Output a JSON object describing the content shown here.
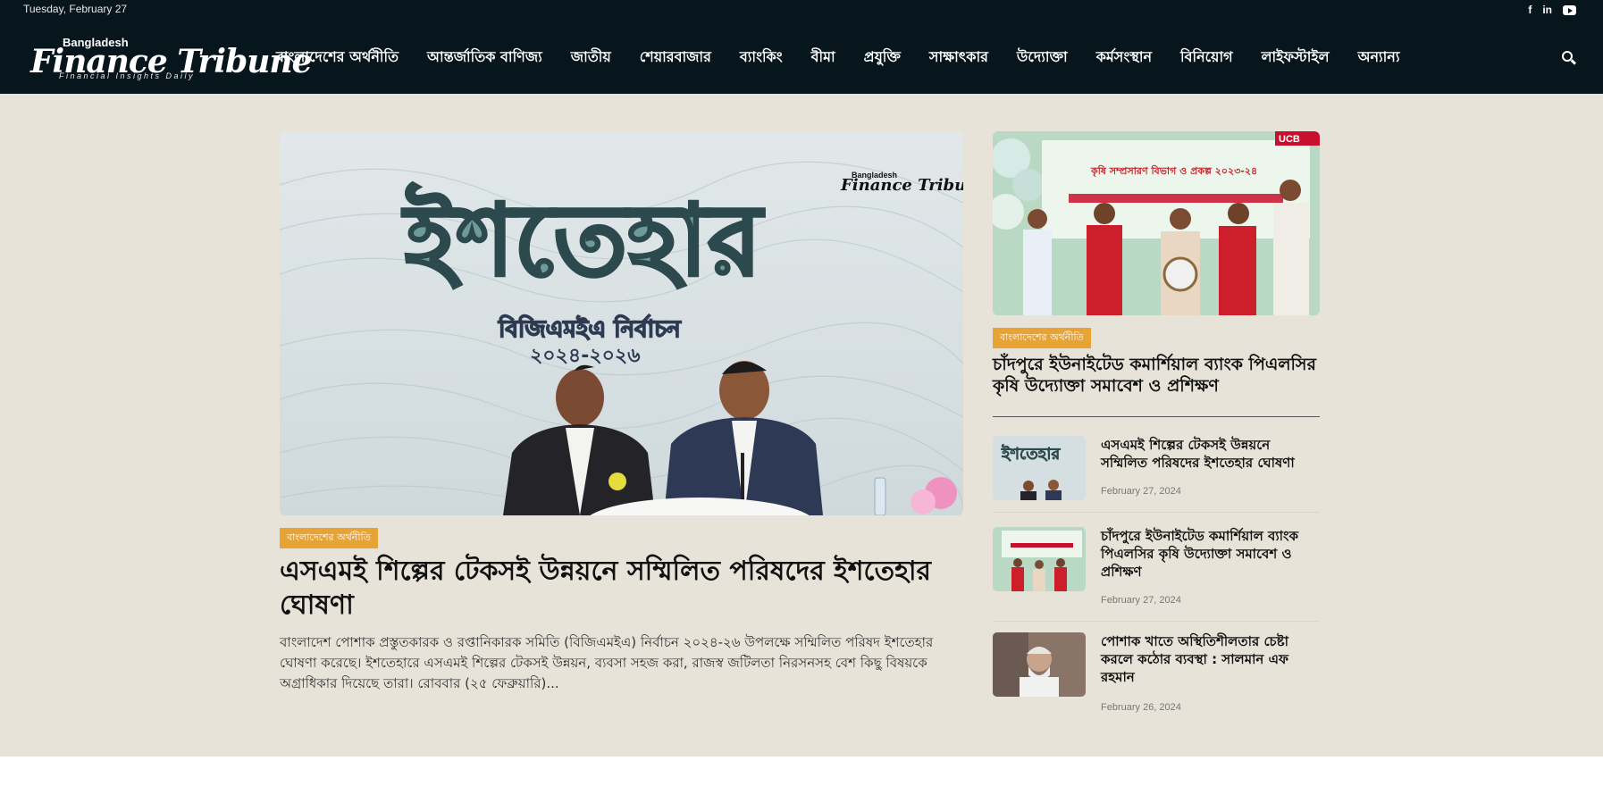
{
  "topbar": {
    "date": "Tuesday, February 27",
    "social": [
      "facebook-icon",
      "linkedin-icon",
      "youtube-icon"
    ],
    "facebook_glyph": "f",
    "linkedin_glyph": "in"
  },
  "header": {
    "logo_small": "Bangladesh",
    "logo_big": "Finance Tribune",
    "logo_tagline": "Financial Insights Daily",
    "nav": [
      "বাংলাদেশের অর্থনীতি",
      "আন্তর্জাতিক বাণিজ্য",
      "জাতীয়",
      "শেয়ারবাজার",
      "ব্যাংকিং",
      "বীমা",
      "প্রযুক্তি",
      "সাক্ষাৎকার",
      "উদ্যোক্তা",
      "কর্মসংস্থান",
      "বিনিয়োগ",
      "লাইফস্টাইল",
      "অন্যান্য"
    ]
  },
  "featured": {
    "category": "বাংলাদেশের অর্থনীতি",
    "title": "এসএমই শিল্পের টেকসই উন্নয়নে সম্মিলিত পরিষদের ইশতেহার ঘোষণা",
    "excerpt": "বাংলাদেশ পোশাক প্রস্তুতকারক ও রপ্তানিকারক সমিতি (বিজিএমইএ) নির্বাচন ২০২৪-২৬ উপলক্ষে সম্মিলিত পরিষদ ইশতেহার ঘোষণা করেছে। ইশতেহারে এসএমই শিল্পের টেকসই উন্নয়ন, ব্যবসা সহজ করা, রাজস্ব জটিলতা নিরসনসহ বেশ কিছু বিষয়কে অগ্রাধিকার দিয়েছে তারা। রোববার (২৫ ফেব্রুয়ারি)...",
    "image": {
      "headline": "ইশতেহার",
      "subline": "বিজিএমইএ নির্বাচন",
      "years": "২০২৪-২০২৬",
      "brand_small": "Bangladesh",
      "brand_big": "Finance Tribune"
    }
  },
  "side_feature": {
    "category": "বাংলাদেশের অর্থনীতি",
    "title": "চাঁদপুরে ইউনাইটেড কমার্শিয়াল ব্যাংক পিএলসির কৃষি উদ্যোক্তা সমাবেশ ও প্রশিক্ষণ",
    "image": {
      "banner_line": "কৃষি সম্প্রসারণ বিভাগ ও প্রকল্প ২০২৩-২৪",
      "logo": "UCB"
    }
  },
  "list": [
    {
      "title": "এসএমই শিল্পের টেকসই উন্নয়নে সম্মিলিত পরিষদের ইশতেহার ঘোষণা",
      "date": "February 27, 2024",
      "thumb_text": "ইশতেহার"
    },
    {
      "title": "চাঁদপুরে ইউনাইটেড কমার্শিয়াল ব্যাংক পিএলসির কৃষি উদ্যোক্তা সমাবেশ ও প্রশিক্ষণ",
      "date": "February 27, 2024"
    },
    {
      "title": "পোশাক খাতে অস্থিতিশীলতার চেষ্টা করলে কঠোর ব্যবস্থা : সালমান এফ রহমান",
      "date": "February 26, 2024"
    }
  ],
  "colors": {
    "header_bg": "#07161d",
    "page_bg": "#e7e3d8",
    "badge": "#e8a335"
  }
}
